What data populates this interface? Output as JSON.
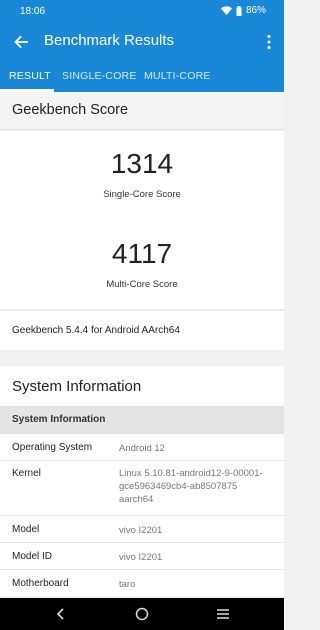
{
  "status": {
    "time": "18:06",
    "battery": "86%"
  },
  "app_bar": {
    "title": "Benchmark Results"
  },
  "tabs": [
    {
      "label": "RESULT"
    },
    {
      "label": "SINGLE-CORE"
    },
    {
      "label": "MULTI-CORE"
    }
  ],
  "geekbench": {
    "header": "Geekbench Score",
    "single_core_score": "1314",
    "single_core_label": "Single-Core Score",
    "multi_core_score": "4117",
    "multi_core_label": "Multi-Core Score",
    "version": "Geekbench 5.4.4 for Android AArch64"
  },
  "system_info": {
    "title": "System Information",
    "subheader": "System Information",
    "rows": [
      {
        "key": "Operating System",
        "value": "Android 12"
      },
      {
        "key": "Kernel",
        "value_lines": [
          "Linux 5.10.81-android12-9-00001-",
          "gce5963469cb4-ab8507875",
          "aarch64"
        ]
      },
      {
        "key": "Model",
        "value": "vivo I2201"
      },
      {
        "key": "Model ID",
        "value": "vivo I2201"
      },
      {
        "key": "Motherboard",
        "value": "taro"
      }
    ]
  },
  "icons": {
    "back": "arrow-back-icon",
    "more": "more-vert-icon",
    "wifi": "wifi-icon",
    "battery": "battery-icon",
    "nav_back": "nav-back-icon",
    "nav_home": "nav-home-icon",
    "nav_recents": "nav-recents-icon"
  },
  "colors": {
    "primary": "#1a88d9",
    "background": "#f2f2f2",
    "subheader": "#e4e4e4"
  }
}
